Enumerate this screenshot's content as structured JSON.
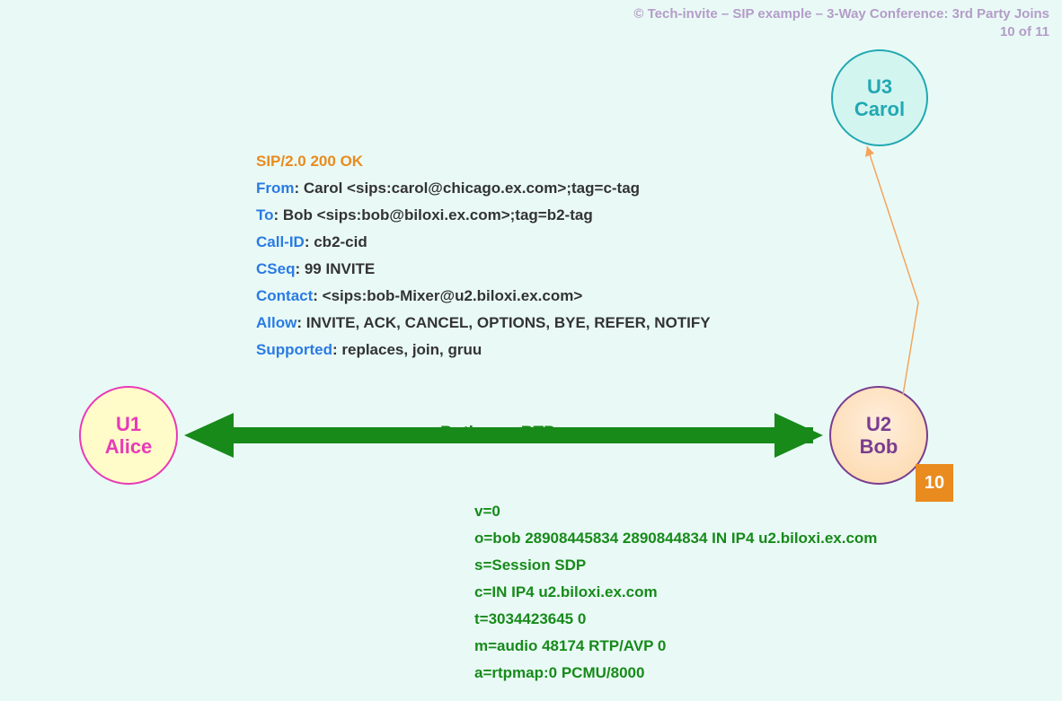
{
  "header": {
    "line1": "© Tech-invite – SIP example – 3-Way Conference: 3rd Party Joins",
    "line2": "10 of 11"
  },
  "nodes": {
    "u1": {
      "id": "U1",
      "name": "Alice"
    },
    "u2": {
      "id": "U2",
      "name": "Bob"
    },
    "u3": {
      "id": "U3",
      "name": "Carol"
    }
  },
  "badge": "10",
  "rtp_label": "Both way RTP",
  "sip": {
    "status": "SIP/2.0 200 OK",
    "headers": {
      "from_label": "From",
      "from_value": ": Carol <sips:carol@chicago.ex.com>;tag=c-tag",
      "to_label": "To",
      "to_value": ": Bob <sips:bob@biloxi.ex.com>;tag=b2-tag",
      "callid_label": "Call-ID",
      "callid_value": ": cb2-cid",
      "cseq_label": "CSeq",
      "cseq_value": ": 99 INVITE",
      "contact_label": "Contact",
      "contact_value": ": <sips:bob-Mixer@u2.biloxi.ex.com>",
      "allow_label": "Allow",
      "allow_value": ": INVITE, ACK, CANCEL, OPTIONS, BYE, REFER, NOTIFY",
      "supported_label": "Supported",
      "supported_value": ": replaces, join, gruu"
    }
  },
  "sdp": {
    "l0": "v=0",
    "l1": "o=bob  28908445834  2890844834  IN  IP4  u2.biloxi.ex.com",
    "l2": "s=Session SDP",
    "l3": "c=IN  IP4  u2.biloxi.ex.com",
    "l4": "t=3034423645  0",
    "l5": "m=audio  48174  RTP/AVP  0",
    "l6": "a=rtpmap:0  PCMU/8000"
  }
}
